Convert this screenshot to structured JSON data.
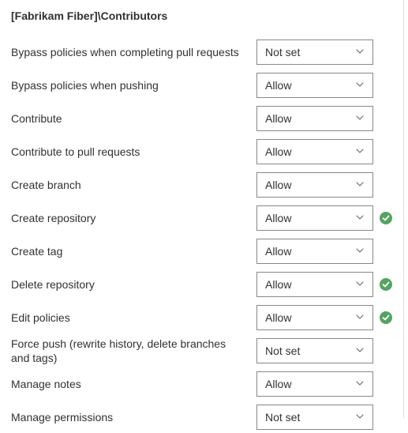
{
  "title": "[Fabrikam Fiber]\\Contributors",
  "status_color": "#55a362",
  "permissions": [
    {
      "label": "Bypass policies when completing pull requests",
      "value": "Not set",
      "inherited": false
    },
    {
      "label": "Bypass policies when pushing",
      "value": "Allow",
      "inherited": false
    },
    {
      "label": "Contribute",
      "value": "Allow",
      "inherited": false
    },
    {
      "label": "Contribute to pull requests",
      "value": "Allow",
      "inherited": false
    },
    {
      "label": "Create branch",
      "value": "Allow",
      "inherited": false
    },
    {
      "label": "Create repository",
      "value": "Allow",
      "inherited": true
    },
    {
      "label": "Create tag",
      "value": "Allow",
      "inherited": false
    },
    {
      "label": "Delete repository",
      "value": "Allow",
      "inherited": true
    },
    {
      "label": "Edit policies",
      "value": "Allow",
      "inherited": true
    },
    {
      "label": "Force push (rewrite history, delete branches and tags)",
      "value": "Not set",
      "inherited": false
    },
    {
      "label": "Manage notes",
      "value": "Allow",
      "inherited": false
    },
    {
      "label": "Manage permissions",
      "value": "Not set",
      "inherited": false
    }
  ]
}
